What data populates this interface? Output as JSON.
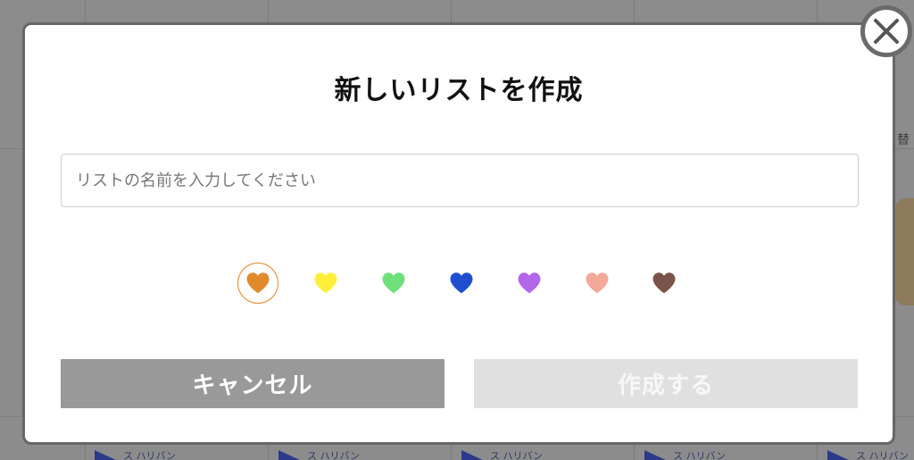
{
  "background": {
    "side_text": "替",
    "badge_text": "ス ハリバン"
  },
  "dialog": {
    "title": "新しいリストを作成",
    "input_placeholder": "リストの名前を入力してください",
    "input_value": "",
    "heart_colors": [
      {
        "name": "orange",
        "color": "#e08a2c",
        "selected": true
      },
      {
        "name": "yellow",
        "color": "#ffef3a",
        "selected": false
      },
      {
        "name": "green",
        "color": "#6ee07a",
        "selected": false
      },
      {
        "name": "blue",
        "color": "#1f4fd1",
        "selected": false
      },
      {
        "name": "purple",
        "color": "#b266ea",
        "selected": false
      },
      {
        "name": "pink",
        "color": "#f2a99a",
        "selected": false
      },
      {
        "name": "brown",
        "color": "#7a5448",
        "selected": false
      }
    ],
    "cancel_label": "キャンセル",
    "create_label": "作成する",
    "close_icon": "close-icon"
  }
}
